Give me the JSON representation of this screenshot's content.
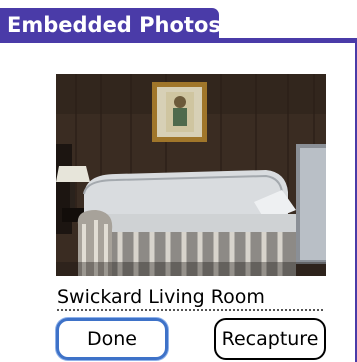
{
  "window": {
    "title": "Embedded Photos",
    "accent_color": "#4a3ba8"
  },
  "photo": {
    "description_name": "living-room-photo",
    "caption": "Swickard Living Room"
  },
  "buttons": {
    "done_label": "Done",
    "recapture_label": "Recapture"
  }
}
